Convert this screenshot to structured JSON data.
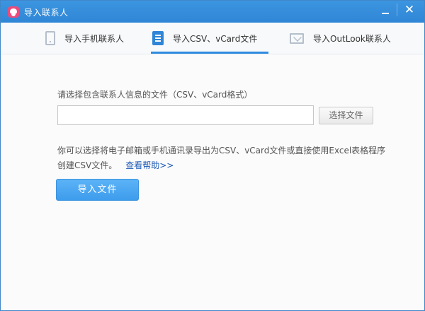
{
  "window": {
    "title": "导入联系人",
    "minimize_icon": "minimize-icon",
    "close_icon": "close-icon",
    "close_glyph": "✕"
  },
  "tabs": [
    {
      "label": "导入手机联系人",
      "icon": "phone-icon",
      "active": false
    },
    {
      "label": "导入CSV、vCard文件",
      "icon": "document-icon",
      "active": true
    },
    {
      "label": "导入OutLook联系人",
      "icon": "mail-icon",
      "active": false
    }
  ],
  "main": {
    "prompt": "请选择包含联系人信息的文件（CSV、vCard格式）",
    "file_input": {
      "value": "",
      "placeholder": ""
    },
    "browse_button": "选择文件",
    "description_line1": "你可以选择将电子邮箱或手机通讯录导出为CSV、vCard文件或直接使用Excel表格程序",
    "description_line2": "创建CSV文件。",
    "help_link": "查看帮助>>",
    "import_button": "导入文件"
  },
  "colors": {
    "titlebar": "#2f86d6",
    "accent": "#2e8be0",
    "import_button": "#4aa8f2",
    "link": "#1a58b5"
  }
}
